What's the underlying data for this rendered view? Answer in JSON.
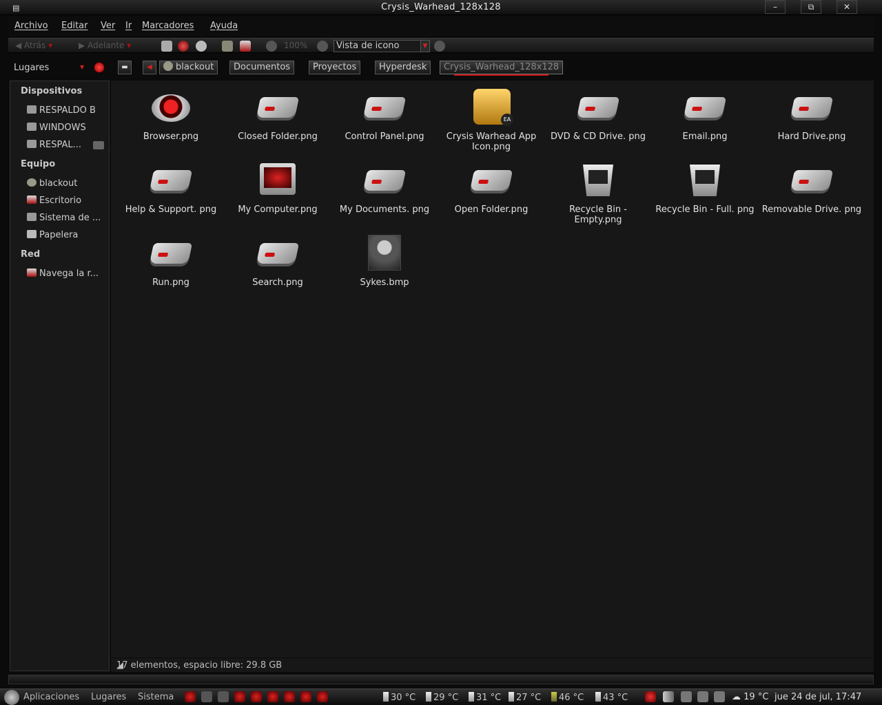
{
  "window": {
    "title": "Crysis_Warhead_128x128",
    "min": "–",
    "max": "⧉",
    "close": "✕"
  },
  "menu": [
    "Archivo",
    "Editar",
    "Ver",
    "Ir",
    "Marcadores",
    "Ayuda"
  ],
  "toolbar": {
    "back": "Atrás",
    "forward": "Adelante",
    "zoom": "100%",
    "view_mode": "Vista de icono"
  },
  "location": {
    "places_label": "Lugares",
    "crumbs": [
      "blackout",
      "Documentos",
      "Proyectos",
      "Hyperdesk",
      "Crysis_Warhead_128x128"
    ]
  },
  "sidebar": {
    "devices_header": "Dispositivos",
    "devices": [
      "RESPALDO B",
      "WINDOWS",
      "RESPAL..."
    ],
    "computer_header": "Equipo",
    "computer": [
      "blackout",
      "Escritorio",
      "Sistema de ...",
      "Papelera"
    ],
    "network_header": "Red",
    "network": [
      "Navega la r..."
    ]
  },
  "files": [
    {
      "name": "Browser.png",
      "icon": "round"
    },
    {
      "name": "Closed Folder.png",
      "icon": "drive"
    },
    {
      "name": "Control Panel.png",
      "icon": "drive"
    },
    {
      "name": "Crysis Warhead App Icon.png",
      "icon": "app"
    },
    {
      "name": "DVD & CD Drive. png",
      "icon": "drive"
    },
    {
      "name": "Email.png",
      "icon": "drive"
    },
    {
      "name": "Hard Drive.png",
      "icon": "drive"
    },
    {
      "name": "Help & Support. png",
      "icon": "drive"
    },
    {
      "name": "My Computer.png",
      "icon": "monitor"
    },
    {
      "name": "My Documents. png",
      "icon": "drive"
    },
    {
      "name": "Open Folder.png",
      "icon": "drive"
    },
    {
      "name": "Recycle Bin - Empty.png",
      "icon": "bin"
    },
    {
      "name": "Recycle Bin - Full. png",
      "icon": "bin"
    },
    {
      "name": "Removable Drive. png",
      "icon": "drive"
    },
    {
      "name": "Run.png",
      "icon": "drive"
    },
    {
      "name": "Search.png",
      "icon": "drive"
    },
    {
      "name": "Sykes.bmp",
      "icon": "photo"
    }
  ],
  "status": "17 elementos, espacio libre: 29.8 GB",
  "panel": {
    "apps": "Aplicaciones",
    "places": "Lugares",
    "system": "Sistema",
    "sensors": [
      "30 °C",
      "29 °C",
      "31 °C",
      "27 °C",
      "46 °C",
      "43 °C"
    ],
    "weather": "19 °C",
    "clock": "jue 24 de jul, 17:47"
  }
}
